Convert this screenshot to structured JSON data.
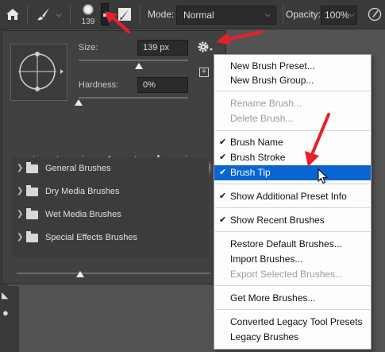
{
  "optbar": {
    "brush_size_badge": "139",
    "mode_label": "Mode:",
    "mode_value": "Normal",
    "opacity_label": "Opacity:",
    "opacity_value": "100%"
  },
  "panel": {
    "size_label": "Size:",
    "size_value": "139 px",
    "hardness_label": "Hardness:",
    "hardness_value": "0%",
    "groups": [
      {
        "label": "General Brushes"
      },
      {
        "label": "Dry Media Brushes"
      },
      {
        "label": "Wet Media Brushes"
      },
      {
        "label": "Special Effects Brushes"
      }
    ]
  },
  "menu": {
    "items": [
      {
        "label": "New Brush Preset..."
      },
      {
        "label": "New Brush Group..."
      },
      {
        "label": "Rename Brush..."
      },
      {
        "label": "Delete Brush..."
      },
      {
        "label": "Brush Name"
      },
      {
        "label": "Brush Stroke"
      },
      {
        "label": "Brush Tip"
      },
      {
        "label": "Show Additional Preset Info"
      },
      {
        "label": "Show Recent Brushes"
      },
      {
        "label": "Restore Default Brushes..."
      },
      {
        "label": "Import Brushes..."
      },
      {
        "label": "Export Selected Brushes..."
      },
      {
        "label": "Get More Brushes..."
      },
      {
        "label": "Converted Legacy Tool Presets"
      },
      {
        "label": "Legacy Brushes"
      }
    ],
    "check_glyph": "✔"
  },
  "colors": {
    "highlight": "#0a64d2",
    "annotation_arrow": "#e8202a"
  }
}
